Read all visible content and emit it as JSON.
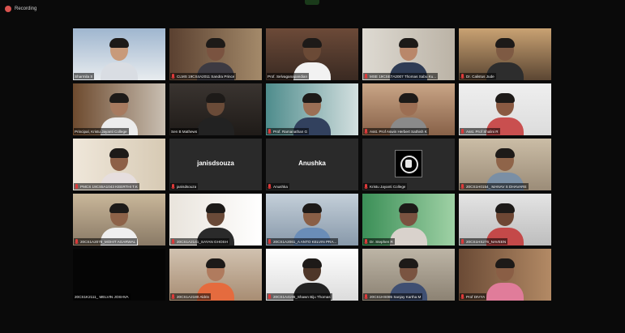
{
  "recording": {
    "label": "Recording"
  },
  "colors": {
    "active_speaker": "#cde64a",
    "muted_mic": "#e03a3a",
    "background": "#0a0a0a"
  },
  "participants": [
    {
      "name": "Sharmila S",
      "muted": false,
      "active": true,
      "video": true
    },
    {
      "name": "CLMS 19CS4A2011 Sandra Prince",
      "muted": true,
      "video": true
    },
    {
      "name": "Prof. Selvaganapandian",
      "muted": false,
      "video": true
    },
    {
      "name": "MSE 19CSE7A2007 Thomas Sabu Ku...",
      "muted": true,
      "video": true
    },
    {
      "name": "Dr. Calistus Jude",
      "muted": true,
      "video": true
    },
    {
      "name": "Principal, Kristu Jayanti College",
      "muted": false,
      "video": true
    },
    {
      "name": "Sen B Mathews",
      "muted": false,
      "video": true
    },
    {
      "name": "Prof. Ramanathan G",
      "muted": true,
      "video": true
    },
    {
      "name": "Asst. Prof Aswin Herbert Sathish K",
      "muted": true,
      "video": true
    },
    {
      "name": "Asst. Prof Shalini R",
      "muted": true,
      "video": true
    },
    {
      "name": "PMCS 19CS5A1043 KEERTHI T.K",
      "muted": true,
      "video": true
    },
    {
      "name": "janisdsouza",
      "muted": true,
      "video": false,
      "display": "janisdsouza"
    },
    {
      "name": "Anushka",
      "muted": true,
      "video": false,
      "display": "Anushka"
    },
    {
      "name": "Kristu Jayanti College",
      "muted": true,
      "video": false,
      "logo": true
    },
    {
      "name": "20CS1H0154_ MANAV S DHAVARE",
      "muted": true,
      "video": true
    },
    {
      "name": "20CS1A2078_MOHIT AGARWAL",
      "muted": true,
      "video": true
    },
    {
      "name": "20CS1A2141_SAYAN GHOSH",
      "muted": true,
      "video": true
    },
    {
      "name": "20CS1A2061_A ANTO KELVIN PRA...",
      "muted": true,
      "video": true
    },
    {
      "name": "Dr. Stephen R",
      "muted": true,
      "video": true
    },
    {
      "name": "20CS1HS276_NAVEEN",
      "muted": true,
      "video": true
    },
    {
      "name": "20CS1K2111_ MELVIN JOSHVA",
      "muted": false,
      "video": false
    },
    {
      "name": "20CS1A2180 Aldrin",
      "muted": true,
      "video": true
    },
    {
      "name": "20CS1A4196_Shawn Biju Thomas",
      "muted": true,
      "video": true
    },
    {
      "name": "20CS1HS085 Sanjay Kartha M",
      "muted": true,
      "video": true
    },
    {
      "name": "Prof DIVYA",
      "muted": true,
      "video": true
    }
  ]
}
